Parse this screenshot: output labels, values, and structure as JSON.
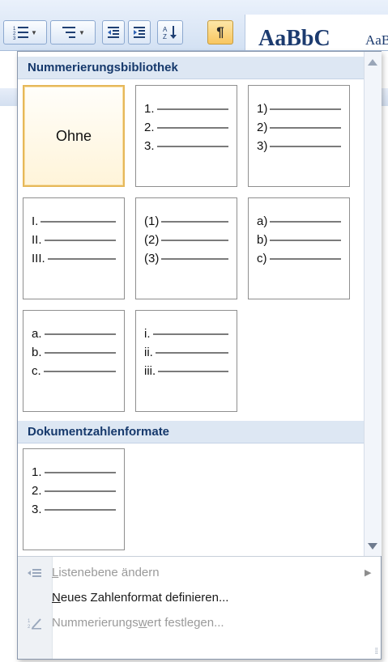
{
  "ribbon": {
    "style_preview_main": "AaBbC",
    "style_preview_small": "AaB"
  },
  "numbering_library": {
    "header": "Nummerierungsbibliothek",
    "none_label": "Ohne",
    "formats": [
      [
        "1.",
        "2.",
        "3."
      ],
      [
        "1)",
        "2)",
        "3)"
      ],
      [
        "I.",
        "II.",
        "III."
      ],
      [
        "(1)",
        "(2)",
        "(3)"
      ],
      [
        "a)",
        "b)",
        "c)"
      ],
      [
        "a.",
        "b.",
        "c."
      ],
      [
        "i.",
        "ii.",
        "iii."
      ]
    ]
  },
  "document_formats": {
    "header": "Dokumentzahlenformate",
    "formats": [
      [
        "1.",
        "2.",
        "3."
      ]
    ]
  },
  "menu": {
    "change_list_level": {
      "pre": "",
      "access": "L",
      "post": "istenebene ändern"
    },
    "define_new_format": {
      "pre": "",
      "access": "N",
      "post": "eues Zahlenformat definieren..."
    },
    "set_numbering_value": {
      "pre": "Nummerierungs",
      "access": "w",
      "post": "ert festlegen..."
    }
  },
  "icons": {
    "numbering": "numbered-list-icon",
    "multilevel": "multilevel-list-icon",
    "decrease_indent": "decrease-indent-icon",
    "increase_indent": "increase-indent-icon",
    "sort": "sort-az-icon",
    "pilcrow": "show-formatting-icon"
  },
  "colors": {
    "header_bg": "#dde7f3",
    "header_text": "#16396c",
    "selected_border": "#e6b85a"
  }
}
